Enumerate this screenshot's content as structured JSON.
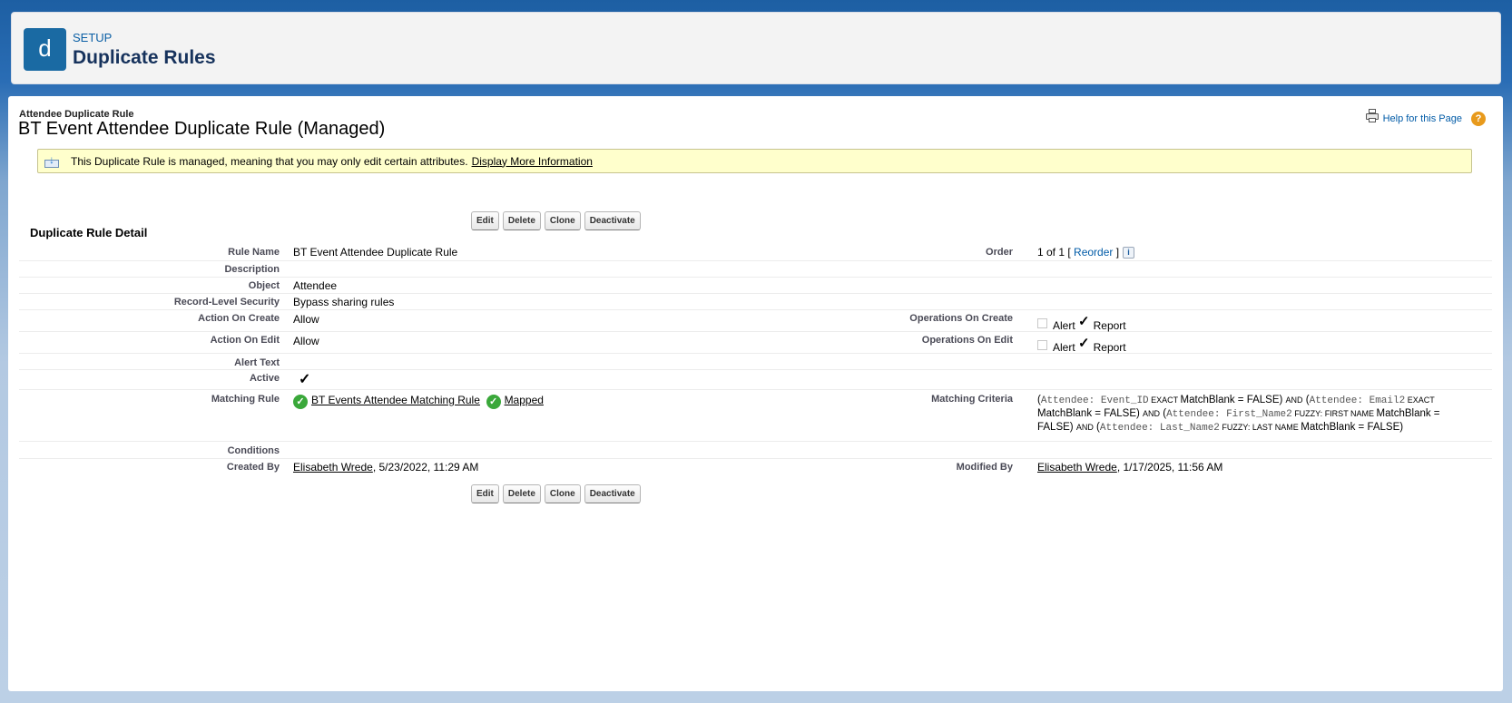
{
  "header": {
    "icon_letter": "d",
    "setup_label": "SETUP",
    "title": "Duplicate Rules"
  },
  "page": {
    "sub_label": "Attendee Duplicate Rule",
    "title": "BT Event Attendee Duplicate Rule (Managed)",
    "help_link": "Help for this Page",
    "help_icon_glyph": "?"
  },
  "banner": {
    "text": "This Duplicate Rule is managed, meaning that you may only edit certain attributes.",
    "link": "Display More Information"
  },
  "detail": {
    "section_title": "Duplicate Rule Detail",
    "buttons": {
      "edit": "Edit",
      "delete": "Delete",
      "clone": "Clone",
      "deactivate": "Deactivate"
    },
    "labels": {
      "rule_name": "Rule Name",
      "description": "Description",
      "object": "Object",
      "record_level_security": "Record-Level Security",
      "action_on_create": "Action On Create",
      "action_on_edit": "Action On Edit",
      "alert_text": "Alert Text",
      "active": "Active",
      "matching_rule": "Matching Rule",
      "conditions": "Conditions",
      "created_by": "Created By",
      "order": "Order",
      "operations_on_create": "Operations On Create",
      "operations_on_edit": "Operations On Edit",
      "matching_criteria": "Matching Criteria",
      "modified_by": "Modified By"
    },
    "values": {
      "rule_name": "BT Event Attendee Duplicate Rule",
      "object": "Attendee",
      "record_level_security": "Bypass sharing rules",
      "action_on_create": "Allow",
      "action_on_edit": "Allow",
      "active_check": "✓",
      "matching_rule_link": "BT Events Attendee Matching Rule",
      "matching_rule_status": "Mapped",
      "created_by_name": "Elisabeth Wrede",
      "created_by_date": ", 5/23/2022, 11:29 AM",
      "order_text": "1 of 1 [ ",
      "order_link": "Reorder",
      "order_close": " ]",
      "info_glyph": "i",
      "alert_label": "Alert",
      "report_label": "Report",
      "modified_by_name": "Elisabeth Wrede",
      "modified_by_date": ", 1/17/2025, 11:56 AM"
    },
    "operations_on_create": {
      "alert": false,
      "report": true
    },
    "operations_on_edit": {
      "alert": false,
      "report": true
    },
    "criteria": {
      "p1": "(",
      "f1": "Attendee: Event_ID",
      "op1": " EXACT ",
      "b1": "MatchBlank = FALSE) ",
      "and1": "AND",
      "p2": " (",
      "f2": "Attendee: Email2",
      "op2": " EXACT ",
      "b2": "MatchBlank = FALSE) ",
      "and2": "AND",
      "p3": " (",
      "f3": "Attendee: First_Name2",
      "op3": " FUZZY: FIRST NAME ",
      "b3": "MatchBlank = FALSE) ",
      "and3": "AND",
      "p4": " (",
      "f4": "Attendee: Last_Name2",
      "op4": " FUZZY: LAST NAME ",
      "b4": "MatchBlank = FALSE)"
    }
  },
  "colors": {
    "accent": "#1a6aa3",
    "link_blue": "#015ba7",
    "banner_bg": "#ffffcc",
    "ok_green": "#3aa83a",
    "help_orange": "#e89a1c"
  }
}
